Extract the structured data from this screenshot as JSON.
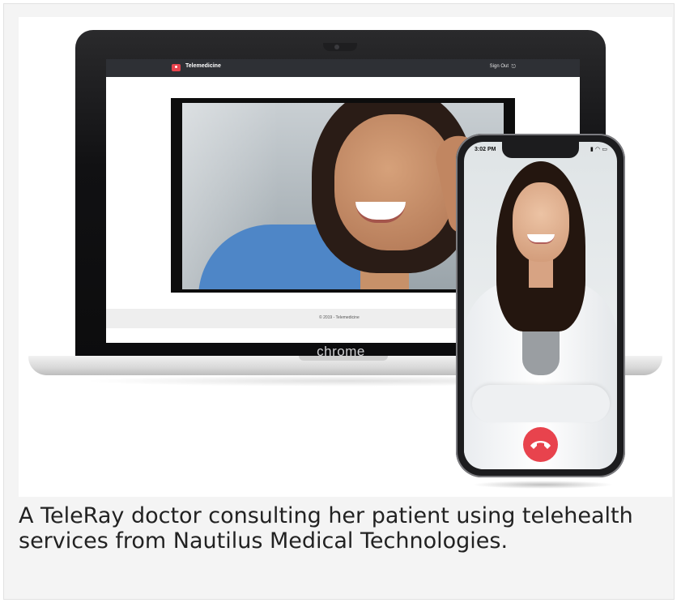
{
  "app": {
    "brand": "Telemedicine",
    "signout_label": "Sign Out",
    "footer": "© 2019 - Telemedicine"
  },
  "laptop": {
    "brand": "chrome"
  },
  "phone": {
    "time": "3:02 PM",
    "status_icons": "signal-icon wifi-icon battery-icon"
  },
  "caption": "A TeleRay doctor consulting her patient using telehealth services from Nautilus Medical Technologies.",
  "colors": {
    "end_call": "#e8434d",
    "navbar": "#2e3035"
  }
}
